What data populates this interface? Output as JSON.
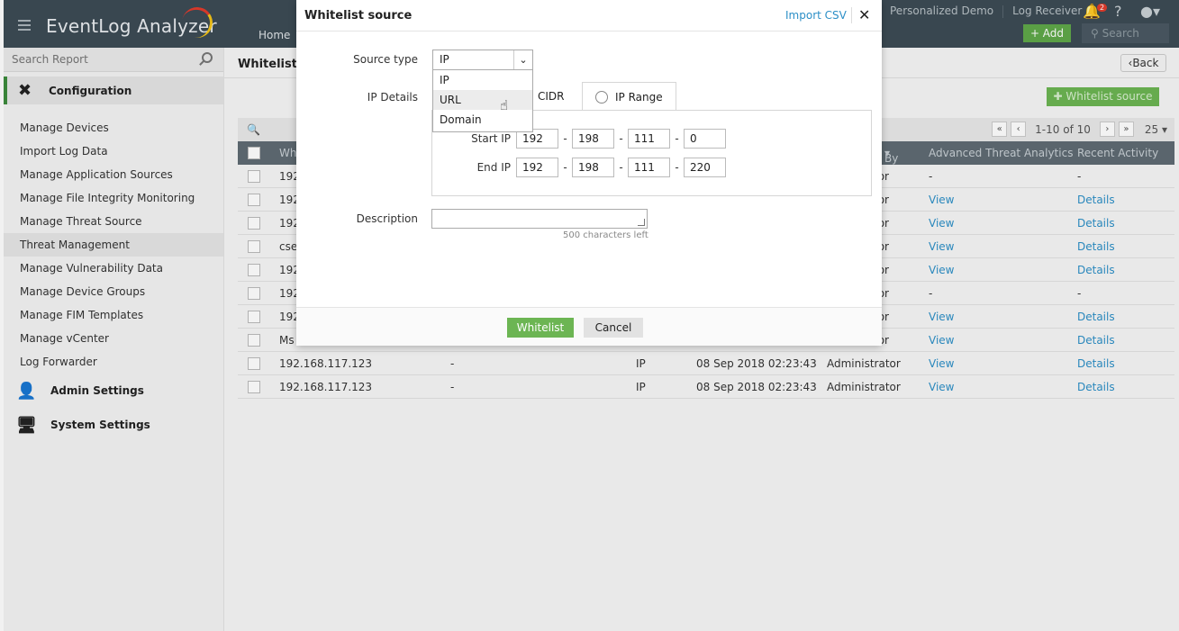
{
  "header": {
    "app_name": "EventLog Analyzer",
    "nav_home": "Home",
    "link_demo": "Personalized Demo",
    "link_log_receiver": "Log Receiver",
    "notification_count": "2",
    "help": "?",
    "add_label": "+ Add",
    "search_placeholder": "Search"
  },
  "sidebar": {
    "search_placeholder": "Search Report",
    "section_title": "Configuration",
    "items": [
      {
        "label": "Manage Devices"
      },
      {
        "label": "Import Log Data"
      },
      {
        "label": "Manage Application Sources"
      },
      {
        "label": "Manage File Integrity Monitoring"
      },
      {
        "label": "Manage Threat Source"
      },
      {
        "label": "Threat Management"
      },
      {
        "label": "Manage Vulnerability Data"
      },
      {
        "label": "Manage Device Groups"
      },
      {
        "label": "Manage FIM Templates"
      },
      {
        "label": "Manage vCenter"
      },
      {
        "label": "Log Forwarder"
      }
    ],
    "admin_settings": "Admin Settings",
    "system_settings": "System Settings"
  },
  "main": {
    "page_title": "Whiteliste",
    "back_label": "Back",
    "whitelist_button": "Whitelist source",
    "pager_range": "1-10 of 10",
    "page_size": "25",
    "columns": {
      "col1": "Wh",
      "added_by": "By",
      "ata": "Advanced Threat Analytics",
      "recent": "Recent Activity"
    },
    "rows": [
      {
        "source": "192",
        "by": "tor",
        "ata": "-",
        "recent": "-"
      },
      {
        "source": "192",
        "by": "tor",
        "ata": "View",
        "recent": "Details"
      },
      {
        "source": "192",
        "by": "tor",
        "ata": "View",
        "recent": "Details"
      },
      {
        "source": "cse",
        "by": "tor",
        "ata": "View",
        "recent": "Details"
      },
      {
        "source": "192",
        "by": "tor",
        "ata": "View",
        "recent": "Details"
      },
      {
        "source": "192",
        "by": "tor",
        "ata": "-",
        "recent": "-"
      },
      {
        "source": "192",
        "by": "tor",
        "ata": "View",
        "recent": "Details"
      },
      {
        "source": "Ms",
        "by": "tor",
        "ata": "View",
        "recent": "Details"
      },
      {
        "source": "192.168.117.123",
        "desc": "-",
        "type": "IP",
        "time": "08 Sep 2018 02:23:43",
        "by": "Administrator",
        "ata": "View",
        "recent": "Details"
      },
      {
        "source": "192.168.117.123",
        "desc": "-",
        "type": "IP",
        "time": "08 Sep 2018 02:23:43",
        "by": "Administrator",
        "ata": "View",
        "recent": "Details"
      }
    ]
  },
  "modal": {
    "title": "Whitelist source",
    "import_csv": "Import CSV",
    "close": "✕",
    "source_type_label": "Source type",
    "source_type_value": "IP",
    "source_type_options": [
      "IP",
      "URL",
      "Domain"
    ],
    "hovered_option": "URL",
    "ip_details_label": "IP Details",
    "tab_cidr": "CIDR",
    "tab_ip_range": "IP Range",
    "start_ip_label": "Start IP",
    "start_ip": [
      "192",
      "198",
      "111",
      "0"
    ],
    "end_ip_label": "End IP",
    "end_ip": [
      "192",
      "198",
      "111",
      "220"
    ],
    "description_label": "Description",
    "description_value": "",
    "chars_left": "500 characters left",
    "whitelist_button": "Whitelist",
    "cancel_button": "Cancel"
  },
  "colors": {
    "header_bg": "#3d4b55",
    "accent_green": "#6cb553",
    "link_blue": "#2c8fc7",
    "table_header": "#5f6b73"
  }
}
